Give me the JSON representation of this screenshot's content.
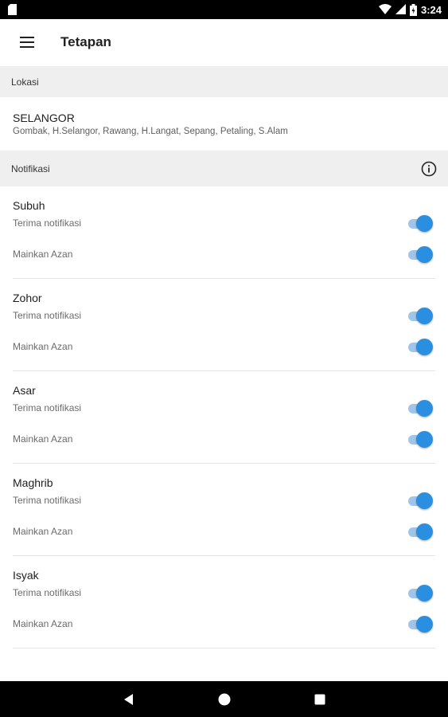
{
  "status_bar": {
    "time": "3:24",
    "icons": [
      "sim-card-icon",
      "wifi-icon",
      "signal-icon",
      "battery-icon"
    ]
  },
  "app_bar": {
    "title": "Tetapan",
    "menu_icon": "hamburger-menu-icon"
  },
  "location_section": {
    "header": "Lokasi",
    "state": "SELANGOR",
    "districts": "Gombak, H.Selangor, Rawang, H.Langat, Sepang, Petaling, S.Alam"
  },
  "notification_section": {
    "header": "Notifikasi",
    "info_icon": "info-icon",
    "prayers": [
      {
        "name": "Subuh",
        "notify_label": "Terima notifikasi",
        "notify_on": true,
        "azan_label": "Mainkan Azan",
        "azan_on": true
      },
      {
        "name": "Zohor",
        "notify_label": "Terima notifikasi",
        "notify_on": true,
        "azan_label": "Mainkan Azan",
        "azan_on": true
      },
      {
        "name": "Asar",
        "notify_label": "Terima notifikasi",
        "notify_on": true,
        "azan_label": "Mainkan Azan",
        "azan_on": true
      },
      {
        "name": "Maghrib",
        "notify_label": "Terima notifikasi",
        "notify_on": true,
        "azan_label": "Mainkan Azan",
        "azan_on": true
      },
      {
        "name": "Isyak",
        "notify_label": "Terima notifikasi",
        "notify_on": true,
        "azan_label": "Mainkan Azan",
        "azan_on": true
      }
    ]
  },
  "colors": {
    "accent": "#2a8fe0",
    "switch_track": "#9fc6ea",
    "section_bg": "#efefef"
  },
  "nav_bar": {
    "icons": [
      "back-icon",
      "home-icon",
      "recents-icon"
    ]
  }
}
